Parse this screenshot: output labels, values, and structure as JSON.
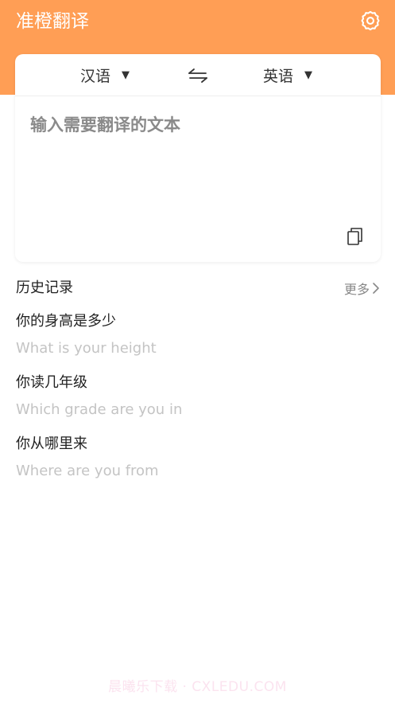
{
  "header": {
    "title": "准橙翻译",
    "settings_icon": "gear-icon",
    "background_color": "#ff9e55"
  },
  "translator": {
    "source_language": "汉语",
    "target_language": "英语",
    "dropdown_icon": "triangle-down-icon",
    "swap_icon": "swap-arrows-icon",
    "input_placeholder": "输入需要翻译的文本",
    "input_value": "",
    "copy_icon": "copy-icon"
  },
  "history": {
    "title": "历史记录",
    "more_label": "更多",
    "more_icon": "chevron-right-icon",
    "items": [
      {
        "source": "你的身高是多少",
        "translation": "What is your height"
      },
      {
        "source": "你读几年级",
        "translation": "Which grade are you in"
      },
      {
        "source": "你从哪里来",
        "translation": "Where are you from"
      }
    ]
  },
  "watermark": "晨曦乐下载 · CXLEDU.COM"
}
